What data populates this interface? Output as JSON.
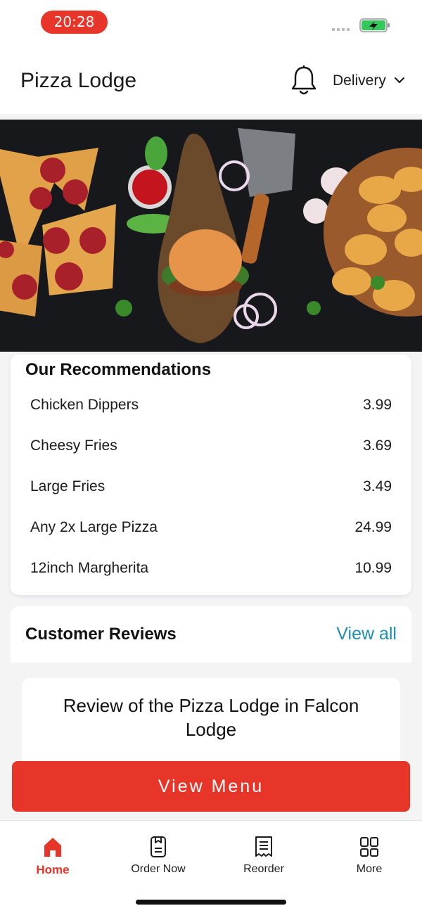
{
  "status_bar": {
    "time": "20:28"
  },
  "header": {
    "title": "Pizza Lodge",
    "delivery_label": "Delivery"
  },
  "recommendations": {
    "title": "Our Recommendations",
    "items": [
      {
        "name": "Chicken Dippers",
        "price": "3.99"
      },
      {
        "name": "Cheesy Fries",
        "price": "3.69"
      },
      {
        "name": "Large Fries",
        "price": "3.49"
      },
      {
        "name": "Any 2x Large Pizza",
        "price": "24.99"
      },
      {
        "name": "12inch Margherita",
        "price": "10.99"
      }
    ]
  },
  "reviews": {
    "title": "Customer Reviews",
    "view_all": "View all",
    "first_review_title": "Review of the Pizza Lodge in Falcon Lodge"
  },
  "cta": {
    "label": "View Menu"
  },
  "tab_bar": {
    "tabs": [
      {
        "label": "Home",
        "icon": "home-icon",
        "active": true
      },
      {
        "label": "Order Now",
        "icon": "order-icon",
        "active": false
      },
      {
        "label": "Reorder",
        "icon": "receipt-icon",
        "active": false
      },
      {
        "label": "More",
        "icon": "grid-icon",
        "active": false
      }
    ]
  },
  "colors": {
    "accent": "#e8352a",
    "link": "#1e8fb0",
    "battery": "#34c759"
  }
}
